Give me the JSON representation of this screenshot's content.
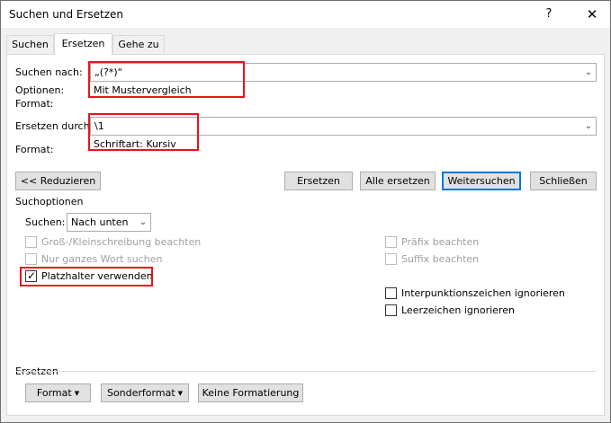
{
  "window": {
    "title": "Suchen und Ersetzen",
    "help_glyph": "?",
    "close_glyph": "✕"
  },
  "tabs": [
    {
      "label": "Suchen"
    },
    {
      "label": "Ersetzen"
    },
    {
      "label": "Gehe zu"
    }
  ],
  "search": {
    "label": "Suchen nach:",
    "value": "„(?*)“",
    "options_label": "Optionen:",
    "options_value": "Mit Mustervergleich",
    "format_label": "Format:"
  },
  "replace": {
    "label": "Ersetzen durch:",
    "value": "\\1",
    "format_label": "Format:",
    "format_value": "Schriftart: Kursiv"
  },
  "buttons": {
    "reduce": "<< Reduzieren",
    "replace": "Ersetzen",
    "replace_all": "Alle ersetzen",
    "find_next": "Weitersuchen",
    "close": "Schließen"
  },
  "search_options": {
    "heading": "Suchoptionen",
    "direction_label": "Suchen:",
    "direction_value": "Nach unten",
    "match_case": "Groß-/Kleinschreibung beachten",
    "whole_word": "Nur ganzes Wort suchen",
    "wildcards": "Platzhalter verwenden",
    "wildcards_checked": true,
    "prefix": "Präfix beachten",
    "suffix": "Suffix beachten",
    "ignore_punct": "Interpunktionszeichen ignorieren",
    "ignore_space": "Leerzeichen ignorieren"
  },
  "replace_section": {
    "heading": "Ersetzen",
    "format_button": "Format",
    "special_button": "Sonderformat",
    "no_format_button": "Keine Formatierung"
  },
  "icons": {
    "dropdown": "chevron-down-icon",
    "checkmark": "checkmark-icon"
  },
  "colors": {
    "highlight": "#e8141c",
    "default_button_border": "#0078d7"
  }
}
